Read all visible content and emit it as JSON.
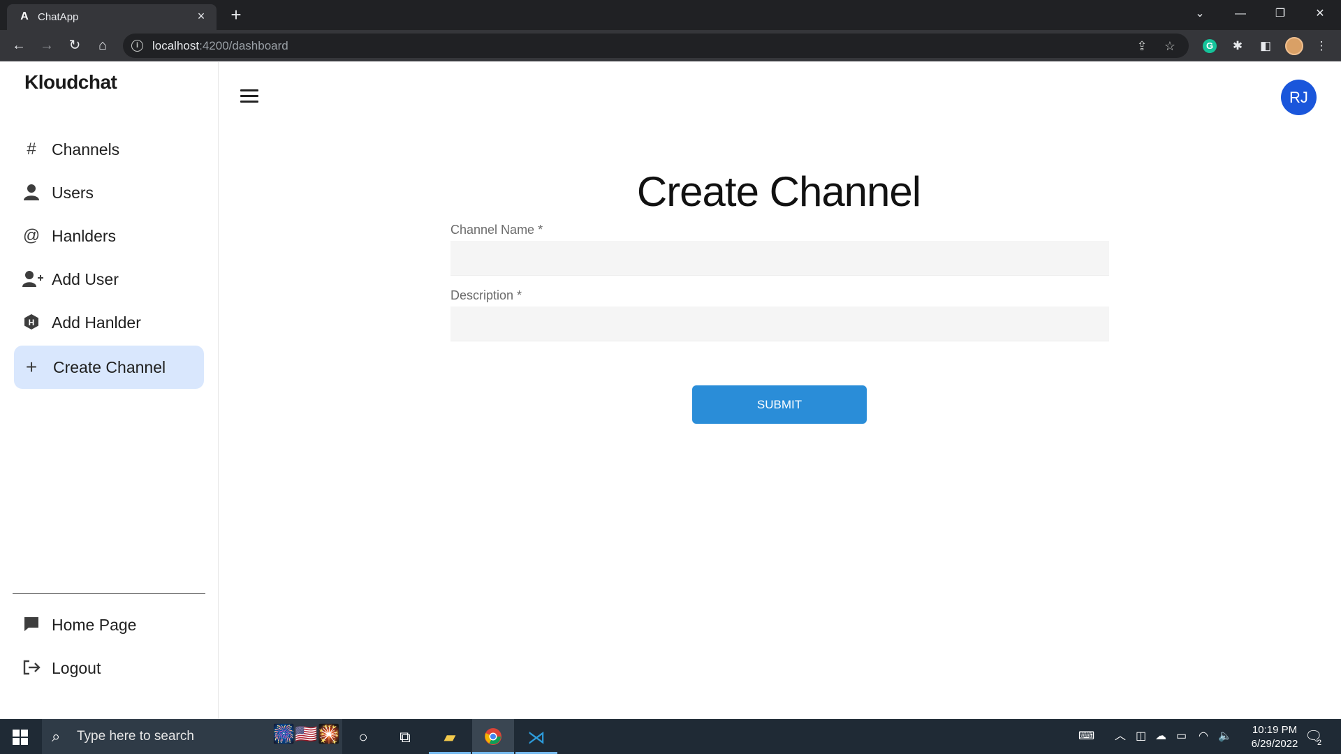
{
  "browser": {
    "tab_title": "ChatApp",
    "tab_favicon": "A",
    "url_host": "localhost",
    "url_path": ":4200/dashboard"
  },
  "sidebar": {
    "brand": "Kloudchat",
    "items": [
      {
        "label": "Channels",
        "icon": "hash-icon",
        "glyph": "#"
      },
      {
        "label": "Users",
        "icon": "user-icon",
        "glyph": "👤"
      },
      {
        "label": "Hanlders",
        "icon": "at-icon",
        "glyph": "@"
      },
      {
        "label": "Add User",
        "icon": "user-plus-icon",
        "glyph": "👤"
      },
      {
        "label": "Add Hanlder",
        "icon": "hexagon-h-icon",
        "glyph": "⬢"
      },
      {
        "label": "Create Channel",
        "icon": "plus-icon",
        "glyph": "+",
        "active": true
      }
    ],
    "bottom_items": [
      {
        "label": "Home Page",
        "icon": "message-icon"
      },
      {
        "label": "Logout",
        "icon": "logout-icon"
      }
    ]
  },
  "header": {
    "avatar_initials": "RJ",
    "avatar_color": "#1a56db"
  },
  "form": {
    "title": "Create Channel",
    "channel_name_label": "Channel Name *",
    "channel_name_value": "",
    "description_label": "Description *",
    "description_value": "",
    "submit_label": "SUBMIT",
    "submit_color": "#2a8dd8",
    "active_nav_color": "#d9e7fd"
  },
  "taskbar": {
    "search_placeholder": "Type here to search",
    "time": "10:19 PM",
    "date": "6/29/2022",
    "notification_count": "2"
  }
}
